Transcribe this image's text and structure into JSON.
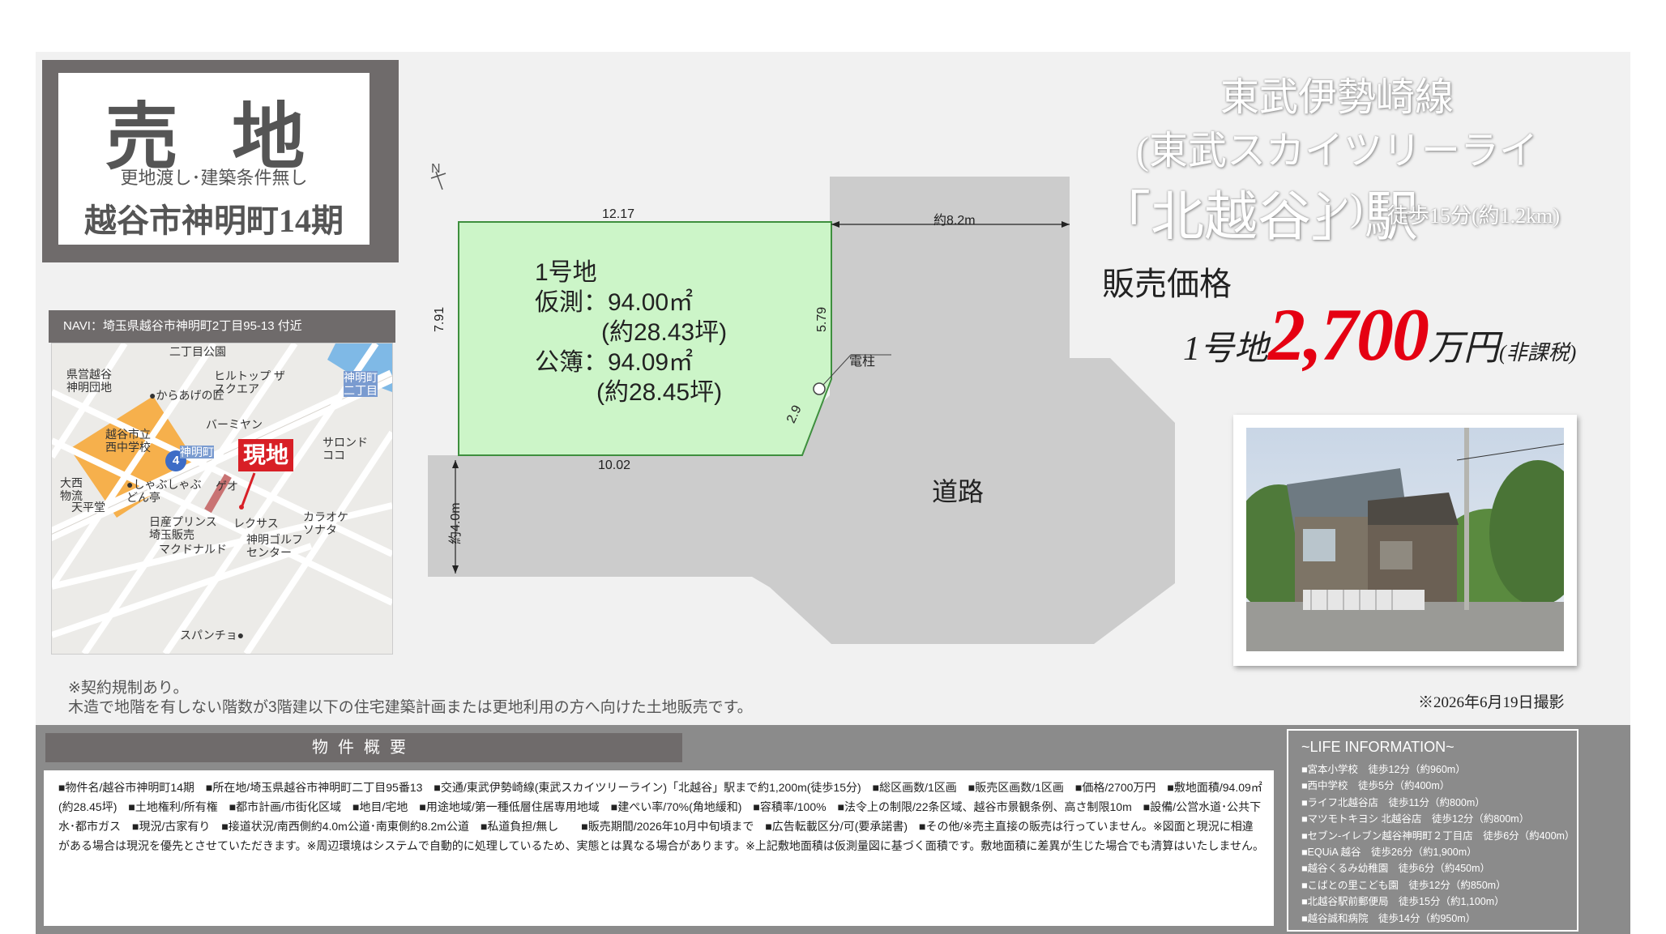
{
  "title": {
    "main": "売 地",
    "sub": "更地渡し･建築条件無し",
    "name": "越谷市神明町14期"
  },
  "map": {
    "header": "NAVI：埼玉県越谷市神明町2丁目95-13 付近",
    "marker": "現地",
    "route_number": "4",
    "labels": {
      "park": "二丁目公園",
      "housing": "県営越谷\n神明団地",
      "karaage": "●からあげの匠",
      "hilltop": "ヒルトップ ザ\nスクエア",
      "shinmei2": "神明町\n二丁目",
      "barmiyan": "バーミヤン",
      "school": "越谷市立\n西中学校",
      "shinmei": "神明町",
      "salon": "サロンド\nココ",
      "onishi": "大西\n物流",
      "shabushabu": "●しゃぶしゃぶ\nどん亭",
      "geo": "ゲオ",
      "tenpei": "天平堂",
      "karaoke": "カラオケ\nソナタ",
      "nissan": "日産プリンス\n埼玉販売",
      "lexus": "レクサス",
      "mcdonalds": "マクドナルド",
      "golf": "神明ゴルフ\nセンター",
      "spancho": "スパンチョ●"
    }
  },
  "plan": {
    "north": "N",
    "dim_top": "12.17",
    "dim_left": "7.91",
    "dim_right": "5.79",
    "dim_corner": "2.9",
    "dim_bottom": "10.02",
    "dim_road_width": "約8.2m",
    "dim_road_side": "約4.0m",
    "pole": "電柱",
    "road": "道路",
    "lot_name": "1号地",
    "survey_area": "仮測：94.00㎡",
    "survey_tsubo": "(約28.43坪)",
    "registry_area": "公簿：94.09㎡",
    "registry_tsubo": "(約28.45坪)"
  },
  "station": {
    "line1": "東武伊勢崎線",
    "line2": "(東武スカイツリーライン)",
    "name": "「北越谷」駅",
    "walk": "徒歩15分(約1.2km)"
  },
  "price": {
    "label": "販売価格",
    "prefix": "1号地",
    "value": "2,700",
    "unit": "万円",
    "tax": "(非課税)"
  },
  "photo": {
    "caption": "※2026年6月19日撮影"
  },
  "notes": {
    "line1": "※契約規制あり。",
    "line2": "木造で地階を有しない階数が3階建以下の住宅建築計画または更地利用の方へ向けた土地販売です。"
  },
  "summary": {
    "title": "物件概要",
    "text": "■物件名/越谷市神明町14期　■所在地/埼玉県越谷市神明町二丁目95番13　■交通/東武伊勢崎線(東武スカイツリーライン)「北越谷」駅まで約1,200m(徒歩15分)　■総区画数/1区画　■販売区画数/1区画　■価格/2700万円　■敷地面積/94.09㎡(約28.45坪)　■土地権利/所有権　■都市計画/市街化区域　■地目/宅地　■用途地域/第一種低層住居専用地域　■建ぺい率/70%(角地緩和)　■容積率/100%　■法令上の制限/22条区域、越谷市景観条例、高さ制限10m　■設備/公営水道･公共下水･都市ガス　■現況/古家有り　■接道状況/南西側約4.0m公道･南東側約8.2m公道　■私道負担/無し　　■販売期間/2026年10月中旬頃まで　■広告転載区分/可(要承諾書)　■その他/※売主直接の販売は行っていません。※図面と現況に相違がある場合は現況を優先とさせていただきます。※周辺環境はシステムで自動的に処理しているため、実態とは異なる場合があります。※上記敷地面積は仮測量図に基づく面積です。敷地面積に差異が生じた場合でも清算はいたしません。"
  },
  "life": {
    "title": "~LIFE INFORMATION~",
    "items": [
      "■宮本小学校　徒歩12分（約960m）",
      "■西中学校　徒歩5分（約400m）",
      "■ライフ北越谷店　徒歩11分（約800m）",
      "■マツモトキヨシ 北越谷店　徒歩12分（約800m）",
      "■セブン-イレブン越谷神明町２丁目店　徒歩6分（約400m）",
      "■EQUiA 越谷　徒歩26分（約1,900m）",
      "■越谷くるみ幼稚園　徒歩6分（約450m）",
      "■こばとの里こども園　徒歩12分（約850m）",
      "■北越谷駅前郵便局　徒歩15分（約1,100m）",
      "■越谷誠和病院　徒歩14分（約950m）"
    ]
  },
  "colors": {
    "price_red": "#e50012",
    "lot_green": "#ccf5c8",
    "road_grey": "#cccccc",
    "panel_grey": "#6f6b6b"
  }
}
